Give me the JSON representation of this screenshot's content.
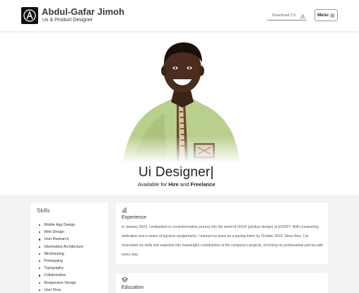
{
  "header": {
    "name": "Abdul-Gafar Jimoh",
    "subtitle": "Ux & Product Designer",
    "download_cv": "Download CV",
    "menu_label": "Menu"
  },
  "hero": {
    "role": "Ui Designer",
    "caret": "|",
    "availability": {
      "prefix": "Available for ",
      "hire": "Hire",
      "connector": " and ",
      "freelance": "Freelance"
    }
  },
  "skills": {
    "title": "Skills",
    "items": [
      "Mobile App Design",
      "Web Design",
      "User Research",
      "Information Architecture",
      "Wireframing",
      "Prototyping",
      "Typography",
      "Collaboration",
      "Responsive Design",
      "User Flow"
    ]
  },
  "experience": {
    "title": "Experience",
    "text": "In January 2023, I embarked on a transformative journey into the world of UI/UX (product design) at EISOFT. With unwavering dedication and a series of rigorous assignments, I earned my place as a paying intern by October 2023. Since then, I've channeled my skills and expertise into meaningful contributions to the company's projects, enriching my professional journey with every step"
  },
  "education": {
    "title": "Education"
  },
  "icons": {
    "logo": "logo-icon",
    "download": "download-icon",
    "menu": "hamburger-icon",
    "experience": "bar-chart-icon",
    "education": "graduation-cap-icon"
  }
}
